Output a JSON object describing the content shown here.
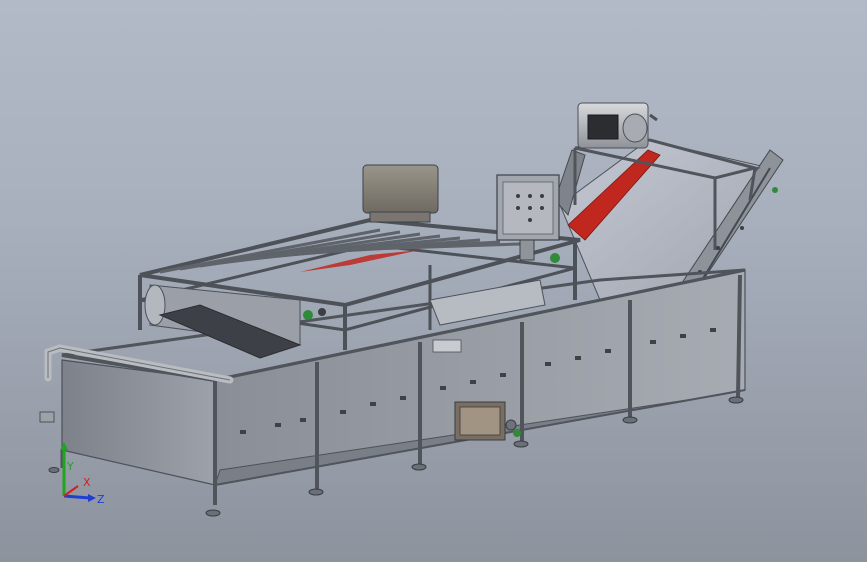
{
  "viewport": {
    "background_top": "#b2bac7",
    "background_bottom": "#8d939d",
    "steel_color": "#8f939a",
    "steel_dark": "#5a5e66",
    "belt_accent": "#c0271f"
  },
  "triad": {
    "x_label": "X",
    "y_label": "Y",
    "z_label": "Z",
    "x_color": "#d21f1f",
    "y_color": "#1fa51f",
    "z_color": "#1f3fd2"
  }
}
